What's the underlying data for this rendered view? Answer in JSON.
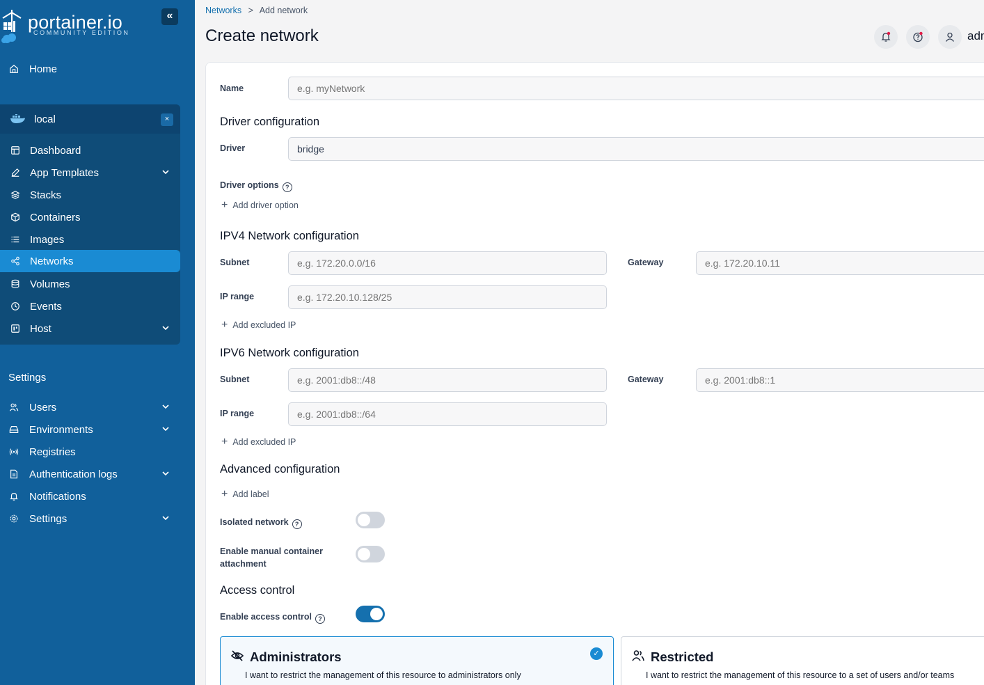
{
  "brand": {
    "title": "portainer.io",
    "subtitle": "COMMUNITY EDITION"
  },
  "sidebar": {
    "home": "Home",
    "environment": {
      "name": "local"
    },
    "env_items": [
      {
        "label": "Dashboard",
        "icon": "dashboard-icon"
      },
      {
        "label": "App Templates",
        "icon": "edit-icon"
      },
      {
        "label": "Stacks",
        "icon": "layers-icon"
      },
      {
        "label": "Containers",
        "icon": "box-icon"
      },
      {
        "label": "Images",
        "icon": "list-icon"
      },
      {
        "label": "Networks",
        "icon": "share-icon"
      },
      {
        "label": "Volumes",
        "icon": "database-icon"
      },
      {
        "label": "Events",
        "icon": "clock-icon"
      },
      {
        "label": "Host",
        "icon": "host-icon"
      }
    ],
    "settings_heading": "Settings",
    "settings_items": [
      {
        "label": "Users"
      },
      {
        "label": "Environments"
      },
      {
        "label": "Registries"
      },
      {
        "label": "Authentication logs"
      },
      {
        "label": "Notifications"
      },
      {
        "label": "Settings"
      }
    ]
  },
  "breadcrumb": {
    "parent": "Networks",
    "separator": ">",
    "current": "Add network"
  },
  "header": {
    "title": "Create network",
    "user": "adm"
  },
  "form": {
    "name_label": "Name",
    "name_placeholder": "e.g. myNetwork",
    "driver_section": "Driver configuration",
    "driver_label": "Driver",
    "driver_value": "bridge",
    "driver_options_label": "Driver options",
    "add_driver_option": "Add driver option",
    "ipv4_section": "IPV4 Network configuration",
    "ipv4_subnet_label": "Subnet",
    "ipv4_subnet_placeholder": "e.g. 172.20.0.0/16",
    "ipv4_gateway_label": "Gateway",
    "ipv4_gateway_placeholder": "e.g. 172.20.10.11",
    "ipv4_range_label": "IP range",
    "ipv4_range_placeholder": "e.g. 172.20.10.128/25",
    "ipv4_add_excluded": "Add excluded IP",
    "ipv6_section": "IPV6 Network configuration",
    "ipv6_subnet_label": "Subnet",
    "ipv6_subnet_placeholder": "e.g. 2001:db8::/48",
    "ipv6_gateway_label": "Gateway",
    "ipv6_gateway_placeholder": "e.g. 2001:db8::1",
    "ipv6_range_label": "IP range",
    "ipv6_range_placeholder": "e.g. 2001:db8::/64",
    "ipv6_add_excluded": "Add excluded IP",
    "advanced_section": "Advanced configuration",
    "add_label": "Add label",
    "isolated_label": "Isolated network",
    "isolated_on": false,
    "manual_attach_label_1": "Enable manual container",
    "manual_attach_label_2": "attachment",
    "manual_attach_on": false,
    "access_section": "Access control",
    "access_toggle_label": "Enable access control",
    "access_on": true
  },
  "access_options": [
    {
      "title": "Administrators",
      "desc": "I want to restrict the management of this resource to administrators only",
      "selected": true
    },
    {
      "title": "Restricted",
      "desc": "I want to restrict the management of this resource to a set of users and/or teams",
      "selected": false
    }
  ],
  "colors": {
    "sidebar": "#11609b",
    "active": "#1a8bd3",
    "accent": "#1570ae"
  }
}
